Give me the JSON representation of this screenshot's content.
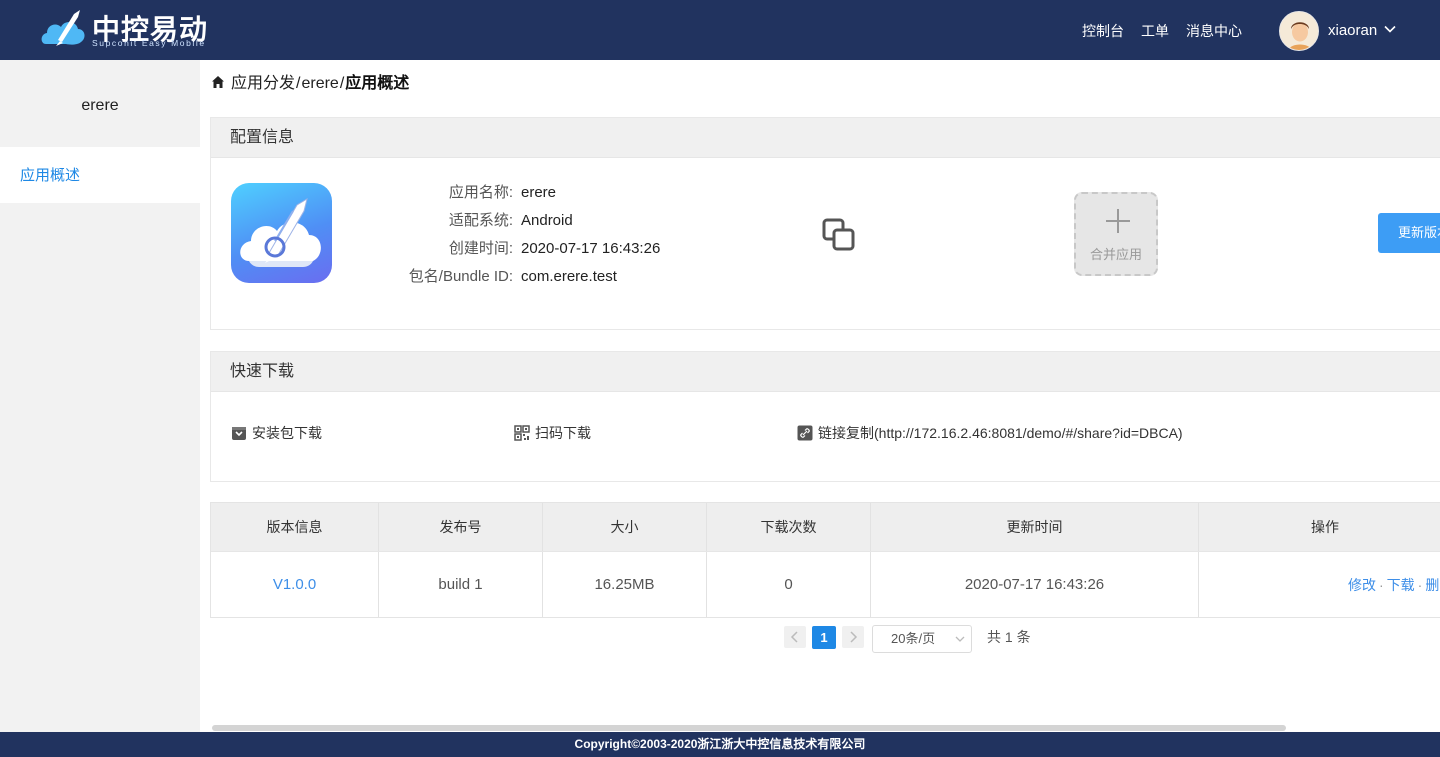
{
  "header": {
    "logo_text": "中控易动",
    "logo_sub": "Supconit Easy Mobile",
    "nav": [
      "控制台",
      "工单",
      "消息中心"
    ],
    "username": "xiaoran"
  },
  "sidebar": {
    "app_name": "erere",
    "items": [
      {
        "label": "应用概述"
      }
    ]
  },
  "breadcrumb": {
    "items": [
      "应用分发",
      "erere"
    ],
    "current": "应用概述",
    "separator": "/"
  },
  "config": {
    "title": "配置信息",
    "fields": [
      {
        "label": "应用名称:",
        "value": "erere"
      },
      {
        "label": "适配系统:",
        "value": "Android"
      },
      {
        "label": "创建时间:",
        "value": "2020-07-17 16:43:26"
      },
      {
        "label": "包名/Bundle ID:",
        "value": "com.erere.test"
      }
    ],
    "merge_label": "合并应用",
    "update_button": "更新版本"
  },
  "quick_download": {
    "title": "快速下载",
    "items": [
      {
        "label": "安装包下载",
        "icon": "package-icon"
      },
      {
        "label": "扫码下载",
        "icon": "qrcode-icon"
      },
      {
        "label": "链接复制(http://172.16.2.46:8081/demo/#/share?id=DBCA)",
        "icon": "link-icon"
      }
    ]
  },
  "table": {
    "headers": [
      "版本信息",
      "发布号",
      "大小",
      "下载次数",
      "更新时间",
      "操作"
    ],
    "rows": [
      {
        "version": "V1.0.0",
        "build": "build 1",
        "size": "16.25MB",
        "downloads": "0",
        "updated": "2020-07-17 16:43:26",
        "actions": [
          "修改",
          "下载",
          "删除"
        ]
      }
    ]
  },
  "pagination": {
    "current": "1",
    "page_size": "20条/页",
    "total": "共 1 条"
  },
  "footer": {
    "copyright": "Copyright©2003-2020浙江浙大中控信息技术有限公司"
  },
  "colors": {
    "header_bg": "#21335f",
    "accent": "#1e88e5",
    "button": "#3d9df5"
  }
}
